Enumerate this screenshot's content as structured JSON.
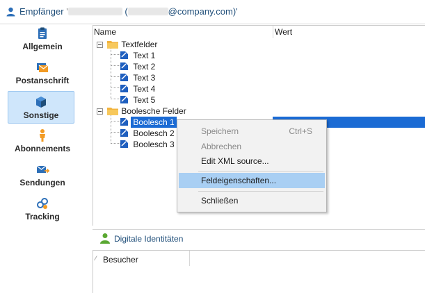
{
  "window": {
    "title_prefix": "Empfänger",
    "title_suffix": "@company.com)'",
    "title_mid": "("
  },
  "sidebar": {
    "items": [
      {
        "label": "Allgemein",
        "icon": "clipboard-icon"
      },
      {
        "label": "Postanschrift",
        "icon": "mail-stack-icon"
      },
      {
        "label": "Sonstige",
        "icon": "cube-icon",
        "active": true
      },
      {
        "label": "Abonnements",
        "icon": "person-icon"
      },
      {
        "label": "Sendungen",
        "icon": "envelope-send-icon"
      },
      {
        "label": "Tracking",
        "icon": "tracking-link-icon"
      }
    ]
  },
  "tree": {
    "columns": {
      "name": "Name",
      "value": "Wert"
    },
    "groups": [
      {
        "label": "Textfelder",
        "children": [
          "Text 1",
          "Text 2",
          "Text 3",
          "Text 4",
          "Text 5"
        ]
      },
      {
        "label": "Boolesche Felder",
        "children": [
          "Boolesch 1",
          "Boolesch 2",
          "Boolesch 3"
        ]
      }
    ],
    "selected": "Boolesch 1"
  },
  "context_menu": {
    "items": [
      {
        "label": "Speichern",
        "shortcut": "Ctrl+S",
        "disabled": true
      },
      {
        "label": "Abbrechen",
        "disabled": true
      },
      {
        "label": "Edit XML source..."
      },
      {
        "label": "Feldeigenschaften...",
        "hover": true
      },
      {
        "label": "Schließen"
      }
    ]
  },
  "identities": {
    "label": "Digitale Identitäten"
  },
  "bottom_table": {
    "column": "Besucher",
    "sort_mark": "⁄"
  },
  "colors": {
    "accent": "#1b6bd4",
    "active_nav": "#cfe6fb",
    "folder": "#f2b33d",
    "field_icon": "#1f5fbf"
  }
}
